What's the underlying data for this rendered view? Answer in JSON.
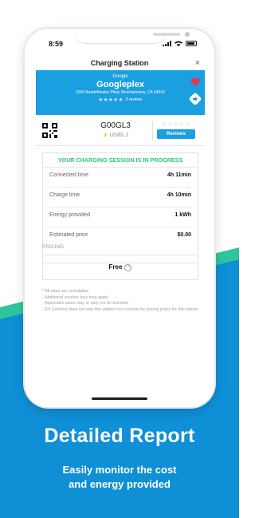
{
  "status_bar": {
    "time": "8:59"
  },
  "nav": {
    "title": "Charging Station",
    "close_icon": "×"
  },
  "station_header": {
    "brand": "Google",
    "name": "Googleplex",
    "address": "1600 Amphitheatre Pkwy Mountainview, CA 94043",
    "review_count": "0 reviews",
    "stars": "★★★★★"
  },
  "station_info": {
    "id": "G00GL3",
    "level": "LEVEL 2",
    "rating_stars": "☆☆☆☆☆",
    "reviews_button": "Reviews"
  },
  "session": {
    "title": "YOUR CHARGING SESSION IS IN PROGRESS",
    "rows": [
      {
        "label": "Connected time",
        "value": "4h 11min"
      },
      {
        "label": "Charge time",
        "value": "4h 10min"
      },
      {
        "label": "Energy provided",
        "value": "1 kWh"
      },
      {
        "label": "Estimated price",
        "value": "$0.00"
      }
    ]
  },
  "pricing": {
    "label": "PRICING",
    "value": "Free",
    "help_icon": "?"
  },
  "notes": [
    "* All rates are cumulative",
    "- Additional session fees may apply",
    "- Applicable taxes may or may not be included",
    "- EV Connect does not own this station nor controls the pricing policy for this station"
  ],
  "promo": {
    "headline": "Detailed Report",
    "subline_1": "Easily monitor the cost",
    "subline_2": "and energy provided"
  },
  "colors": {
    "brand_blue": "#1a9fe0",
    "accent_green": "#2fc46d",
    "heart_red": "#e8354a",
    "background_blue": "#0f8fd6",
    "background_green": "#2ec59b"
  },
  "icons": [
    "qr-code-icon",
    "lightning-icon",
    "heart-icon",
    "directions-icon",
    "close-icon",
    "help-icon",
    "star-icon",
    "signal-icon",
    "wifi-icon",
    "battery-icon"
  ]
}
